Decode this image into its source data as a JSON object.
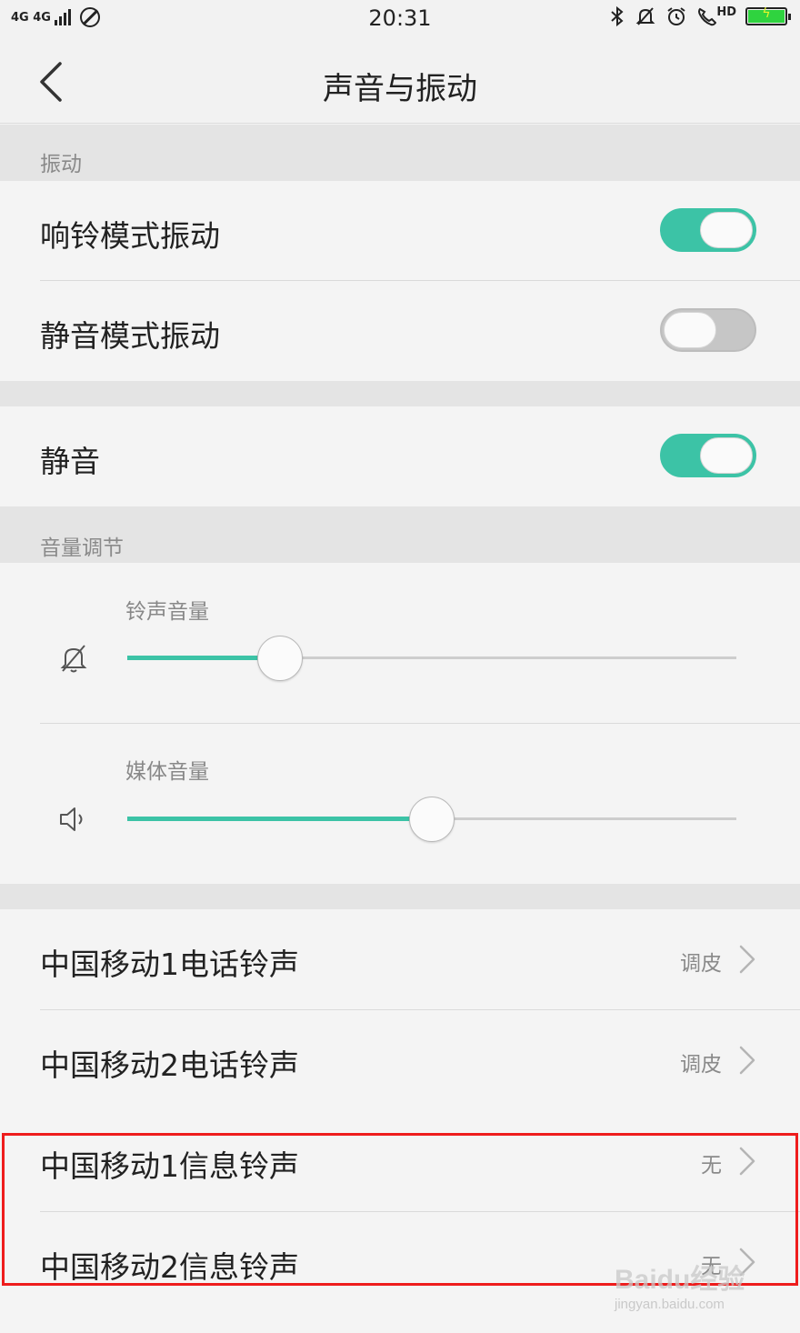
{
  "status_bar": {
    "network_label": "4G 4G",
    "time": "20:31",
    "hd_label": "HD",
    "battery_level": 1.0,
    "battery_color": "#2fd33f"
  },
  "nav": {
    "title": "声音与振动",
    "back_icon": "chevron-left-icon"
  },
  "sections": {
    "vibration": {
      "header": "振动"
    },
    "volume": {
      "header": "音量调节"
    }
  },
  "vibration": {
    "ring_mode": {
      "label": "响铃模式振动",
      "on": true
    },
    "silent_mode": {
      "label": "静音模式振动",
      "on": false
    }
  },
  "mute": {
    "label": "静音",
    "on": true
  },
  "volume": {
    "ringtone": {
      "label": "铃声音量",
      "icon": "bell-muted-icon",
      "level": 0.25
    },
    "media": {
      "label": "媒体音量",
      "icon": "speaker-icon",
      "level": 0.5
    }
  },
  "ringtones": [
    {
      "label": "中国移动1电话铃声",
      "value": "调皮"
    },
    {
      "label": "中国移动2电话铃声",
      "value": "调皮"
    },
    {
      "label": "中国移动1信息铃声",
      "value": "无"
    },
    {
      "label": "中国移动2信息铃声",
      "value": "无"
    }
  ],
  "colors": {
    "accent": "#3cc3a6",
    "highlight_border": "#ee1c1c"
  },
  "watermark": {
    "logo": "Baidu经验",
    "url": "jingyan.baidu.com"
  }
}
